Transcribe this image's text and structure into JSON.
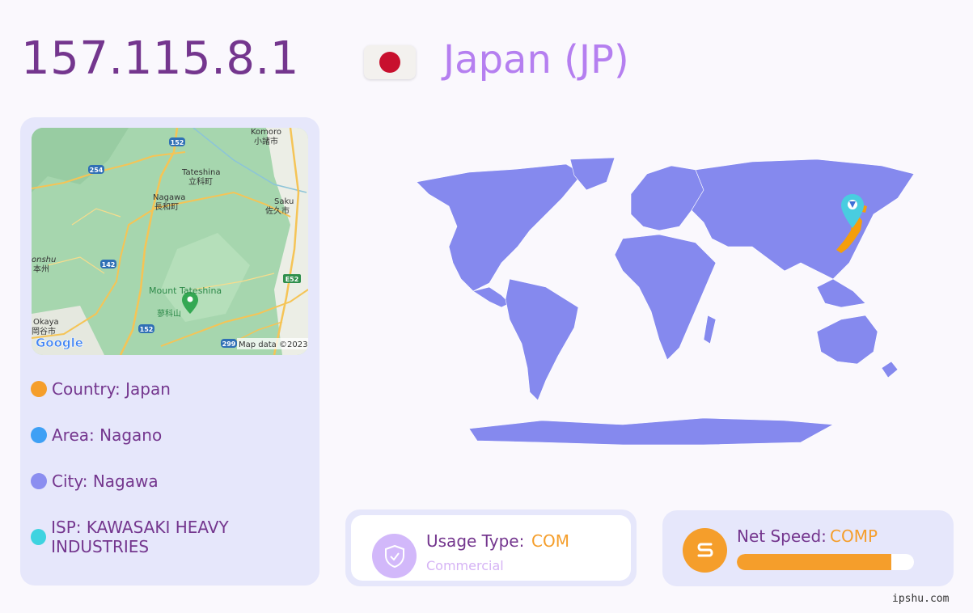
{
  "ip_address": "157.115.8.1",
  "country_title": "Japan (JP)",
  "map": {
    "places": [
      {
        "en": "Komoro",
        "jp": "小諸市"
      },
      {
        "en": "Tateshina",
        "jp": "立科町"
      },
      {
        "en": "Nagawa",
        "jp": "長和町"
      },
      {
        "en": "Saku",
        "jp": "佐久市"
      },
      {
        "en": "onshu",
        "jp": "本州"
      },
      {
        "en": "Mount Tateshina",
        "jp": "蓼科山"
      },
      {
        "en": "Okaya",
        "jp": "岡谷市"
      }
    ],
    "roads": [
      "152",
      "254",
      "142",
      "E52",
      "152",
      "299"
    ],
    "attribution": "Map data ©2023",
    "logo_text": "Google"
  },
  "info": {
    "country": "Country: Japan",
    "area": "Area: Nagano",
    "city": "City: Nagawa",
    "isp": "ISP: KAWASAKI HEAVY INDUSTRIES"
  },
  "bullet_colors": {
    "country": "#f59e2b",
    "area": "#3ea0f5",
    "city": "#8b8ef0",
    "isp": "#3ed3e0"
  },
  "usage": {
    "label": "Usage Type:",
    "value": "COM",
    "description": "Commercial",
    "icon": "shield-check-icon"
  },
  "speed": {
    "label": "Net Speed:",
    "value": "COMP",
    "level_fraction": 0.87,
    "icon": "speed-route-icon"
  },
  "watermark": "ipshu.com",
  "colors": {
    "ip_text": "#74368e",
    "country_title": "#b57ff0",
    "card_bg": "#e6e7fb",
    "accent_orange": "#f59e2b",
    "world_land": "#8589ee",
    "highlight_country": "#f59e0b",
    "marker": "#49cde0"
  }
}
